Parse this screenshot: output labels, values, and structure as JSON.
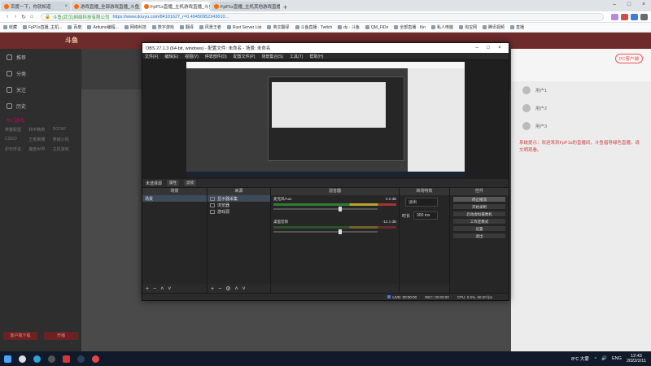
{
  "browser": {
    "tabs": [
      {
        "title": "百度一下，你就知道",
        "active": false
      },
      {
        "title": "游戏直播_全部游戏直播_斗鱼直播",
        "active": false
      },
      {
        "title": "FpP1s直播_主机游戏直播_斗鱼",
        "active": true
      },
      {
        "title": "FpP1s直播_主机其他游戏直播",
        "active": false
      }
    ],
    "url_site": "斗鱼(武汉)网络科技有限公司",
    "url": "https://www.douyu.com/84101627_r=0.49450952343610...",
    "bookmarks": [
      "收藏",
      "FpP1s直播_主机...",
      "百度",
      "Arduino编程...",
      "网络科技",
      "数字游戏",
      "翻译",
      "风景王者",
      "Rust Server List",
      "英文翻译",
      "斗鱼直播 · Twitch",
      "dy · 斗鱼",
      "QM_FiDo",
      "全部直播 · Kin",
      "私人电脑",
      "淘宝网",
      "腾讯视频",
      "直播"
    ]
  },
  "douyu": {
    "logo": "斗鱼",
    "left_nav": [
      "推荐",
      "分类",
      "关注",
      "历史"
    ],
    "left_section": "热门游戏",
    "left_grid": [
      "英雄联盟",
      "和平精英",
      "DOTA2",
      "CSGO",
      "王者荣耀",
      "穿越火线",
      "炉石传说",
      "魔兽世界",
      "主机游戏"
    ],
    "left_buttons": [
      "客户端下载",
      "开播"
    ],
    "pc_button": "PC客户端",
    "ranks": [
      "用户1",
      "用户2",
      "用户3"
    ],
    "chat_notice": "系统提示：欢迎来到FpP1s的直播间，斗鱼倡导绿色直播，请文明观看。"
  },
  "obs": {
    "title": "OBS 27.1.3 (64-bit, windows) - 配置文件: 未命名 - 场景: 未命名",
    "menu": [
      "文件(F)",
      "编辑(E)",
      "视图(V)",
      "停靠部件(D)",
      "配置文件(P)",
      "场景集合(S)",
      "工具(T)",
      "帮助(H)"
    ],
    "scene_tab_label": "未选择源",
    "scene_tab_pills": [
      "属性",
      "滤镜"
    ],
    "docks": {
      "scenes": {
        "header": "场景",
        "items": [
          "场景"
        ]
      },
      "sources": {
        "header": "来源",
        "items": [
          "显示器采集",
          "浏览器",
          "游戏源"
        ]
      },
      "mixer": {
        "header": "混音器",
        "channels": [
          {
            "name": "麦克风/Aux",
            "db": "0.0 dB"
          },
          {
            "name": "桌面音频",
            "db": "-12.1 dB"
          }
        ]
      },
      "transitions": {
        "header": "转场特效",
        "type": "淡出",
        "duration_label": "时长",
        "duration": "300 ms"
      },
      "controls": {
        "header": "控件",
        "buttons": [
          "停止推流",
          "开始录制",
          "启动虚拟摄像机",
          "工作室模式",
          "设置",
          "退出"
        ]
      }
    },
    "status": {
      "live": "LIVE: 00:00:00",
      "rec": "REC: 00:00:00",
      "cpu": "CPU: 0.0%, 60.00 fps"
    }
  },
  "taskbar": {
    "weather": "8°C 大雾",
    "lang": "ENG",
    "time": "12:43",
    "date": "2022/2/11"
  }
}
